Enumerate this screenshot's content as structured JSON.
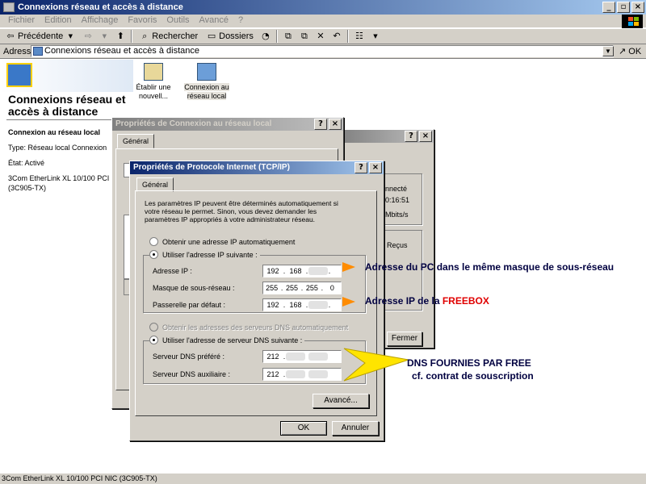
{
  "window": {
    "title": "Connexions réseau et accès à distance",
    "buttons": {
      "minimize": "_",
      "restore": "▫",
      "close": "×"
    }
  },
  "menu": [
    "Fichier",
    "Edition",
    "Affichage",
    "Favoris",
    "Outils",
    "Avancé",
    "?"
  ],
  "toolbar": {
    "back": "Précédente",
    "search": "Rechercher",
    "folders": "Dossiers"
  },
  "address": {
    "label": "Adresse",
    "value": "Connexions réseau et accès à distance",
    "go": "OK"
  },
  "left_pane": {
    "title": "Connexions réseau et accès à distance",
    "connection_name": "Connexion au réseau local",
    "type": "Type: Réseau local Connexion",
    "state": "État: Activé",
    "adapter": "3Com EtherLink XL 10/100 PCI NIC (3C905-TX)"
  },
  "icons": [
    {
      "label": "Établir une nouvell..."
    },
    {
      "label": "Connexion au réseau local"
    }
  ],
  "status_dialog": {
    "partial": [
      "nnecté",
      "0:16:51",
      "Mbits/s",
      "Reçus",
      "Fermer"
    ]
  },
  "props_dialog": {
    "title": "Propriétés de Connexion au réseau local",
    "tab": "Général"
  },
  "tcpip_dialog": {
    "title": "Propriétés de Protocole Internet (TCP/IP)",
    "tab": "Général",
    "intro": "Les paramètres IP peuvent être déterminés automatiquement si votre réseau le permet. Sinon, vous devez demander les paramètres IP appropriés à votre administrateur réseau.",
    "radio_auto_ip": "Obtenir une adresse IP automatiquement",
    "radio_manual_ip": "Utiliser l'adresse IP suivante :",
    "ip_label": "Adresse IP :",
    "ip_value": [
      "192",
      "168"
    ],
    "mask_label": "Masque de sous-réseau :",
    "mask_value": [
      "255",
      "255",
      "255",
      "0"
    ],
    "gateway_label": "Passerelle par défaut :",
    "gateway_value": [
      "192",
      "168"
    ],
    "radio_auto_dns": "Obtenir les adresses des serveurs DNS automatiquement",
    "radio_manual_dns": "Utiliser l'adresse de serveur DNS suivante :",
    "dns1_label": "Serveur DNS préféré :",
    "dns1_value": "212",
    "dns2_label": "Serveur DNS auxiliaire :",
    "dns2_value": "212",
    "advanced": "Avancé...",
    "ok": "OK",
    "cancel": "Annuler"
  },
  "annotations": {
    "ip_note": "Adresse du PC dans le même masque de sous-réseau",
    "gateway_note": "Adresse IP de la ",
    "gateway_brand": "FREEBOX",
    "dns_note_1": "DNS FOURNIES PAR FREE",
    "dns_note_2": "cf. contrat de souscription"
  },
  "status_bar": "3Com EtherLink XL 10/100 PCI NIC (3C905-TX)",
  "colors": {
    "title_active": "#0a246a",
    "arrow_orange": "#ff8c00",
    "arrow_yellow": "#ffe400",
    "annotation_red": "#e00000"
  }
}
